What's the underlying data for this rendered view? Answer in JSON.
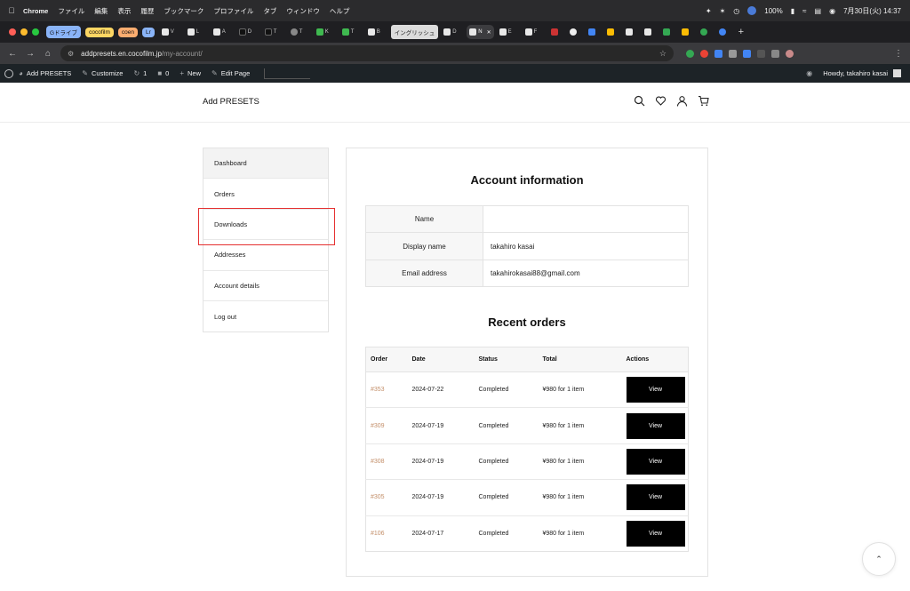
{
  "menubar": {
    "app": "Chrome",
    "items": [
      "ファイル",
      "編集",
      "表示",
      "履歴",
      "ブックマーク",
      "プロファイル",
      "タブ",
      "ウィンドウ",
      "ヘルプ"
    ],
    "battery": "100%",
    "clock": "7月30日(火) 14:37"
  },
  "tabs": {
    "groups": [
      {
        "label": "Gドライブ",
        "color": "#8ab4f8"
      },
      {
        "label": "cocofilm",
        "color": "#fdd663"
      },
      {
        "label": "coen",
        "color": "#fcad70"
      },
      {
        "label": "Lr",
        "color": "#8ab4f8"
      }
    ],
    "items": [
      "V",
      "L",
      "A",
      "D",
      "T",
      "T",
      "K",
      "T",
      "B"
    ],
    "pill": "イングリッシュ",
    "pill_after": "D",
    "active": "N",
    "rest": [
      "E",
      "F",
      "",
      "",
      "",
      "",
      "",
      "",
      "",
      "",
      "",
      "",
      "",
      "",
      "",
      "",
      "",
      ""
    ]
  },
  "address": {
    "host": "addpresets.en.cocofilm.jp",
    "path": "/my-account/"
  },
  "wpbar": {
    "site": "Add PRESETS",
    "customize": "Customize",
    "updates": "1",
    "comments": "0",
    "new": "New",
    "edit": "Edit Page",
    "howdy": "Howdy, takahiro kasai"
  },
  "site": {
    "brand": "Add PRESETS"
  },
  "account_nav": [
    {
      "label": "Dashboard",
      "active": true
    },
    {
      "label": "Orders",
      "active": false
    },
    {
      "label": "Downloads",
      "active": false
    },
    {
      "label": "Addresses",
      "active": false
    },
    {
      "label": "Account details",
      "active": false
    },
    {
      "label": "Log out",
      "active": false
    }
  ],
  "account_info": {
    "title": "Account information",
    "rows": [
      {
        "key": "Name",
        "value": ""
      },
      {
        "key": "Display name",
        "value": "takahiro kasai"
      },
      {
        "key": "Email address",
        "value": "takahirokasai88@gmail.com"
      }
    ]
  },
  "recent_orders": {
    "title": "Recent orders",
    "headers": [
      "Order",
      "Date",
      "Status",
      "Total",
      "Actions"
    ],
    "rows": [
      {
        "order": "#353",
        "date": "2024-07-22",
        "status": "Completed",
        "total": "¥980 for 1 item",
        "action": "View"
      },
      {
        "order": "#309",
        "date": "2024-07-19",
        "status": "Completed",
        "total": "¥980 for 1 item",
        "action": "View"
      },
      {
        "order": "#308",
        "date": "2024-07-19",
        "status": "Completed",
        "total": "¥980 for 1 item",
        "action": "View"
      },
      {
        "order": "#305",
        "date": "2024-07-19",
        "status": "Completed",
        "total": "¥980 for 1 item",
        "action": "View"
      },
      {
        "order": "#106",
        "date": "2024-07-17",
        "status": "Completed",
        "total": "¥980 for 1 item",
        "action": "View"
      }
    ]
  },
  "colors": {
    "highlight": "#e53030",
    "order_link": "#c4906b",
    "wpbar": "#1d2327"
  }
}
